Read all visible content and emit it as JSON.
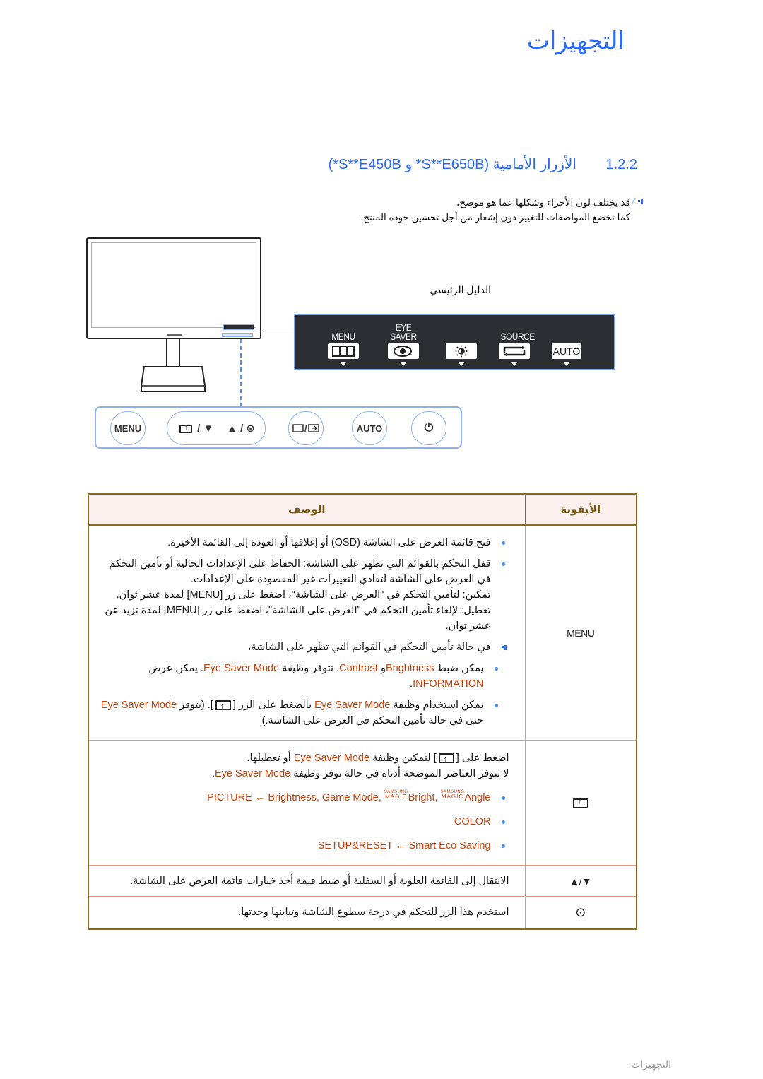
{
  "page": {
    "title": "التجهيزات",
    "footer": "التجهيزات"
  },
  "section": {
    "number": "1.2.2",
    "heading": "الأزرار الأمامية (S**E650B* و S**E450B*)"
  },
  "note": {
    "icon": "note-icon",
    "line1": "قد يختلف لون الأجزاء وشكلها عما هو موضح،",
    "line2": "كما تخضع المواصفات للتغيير دون إشعار من أجل تحسين جودة المنتج."
  },
  "key_guide": {
    "label": "الدليل الرئيسي",
    "keys": [
      {
        "top": "",
        "label": "MENU",
        "icon": "menu-grid-icon"
      },
      {
        "top": "EYE",
        "label": "SAVER",
        "icon": "eye-saver-icon"
      },
      {
        "top": "",
        "label": "",
        "icon": "brightness-icon"
      },
      {
        "top": "",
        "label": "SOURCE",
        "icon": "source-icon"
      },
      {
        "top": "",
        "label": "",
        "icon": "auto-icon",
        "box_text": "AUTO"
      }
    ]
  },
  "front_buttons": [
    {
      "label": "MENU",
      "name": "menu"
    },
    {
      "label": "▼",
      "name": "eye-saver-down"
    },
    {
      "label": "▲ / ⊙",
      "name": "up-brightness"
    },
    {
      "label": "",
      "name": "source-enter"
    },
    {
      "label": "AUTO",
      "name": "auto"
    },
    {
      "label": "⏻",
      "name": "power"
    }
  ],
  "table": {
    "headers": {
      "icon": "الأيقونة",
      "description": "الوصف"
    },
    "rows": [
      {
        "key": "MENU",
        "items": [
          "فتح قائمة العرض على الشاشة (OSD) أو إغلاقها أو العودة إلى القائمة الأخيرة.",
          "قفل التحكم بالقوائم التي تظهر على الشاشة: الحفاظ على الإعدادات الحالية أو تأمين التحكم في العرض على الشاشة لتفادي التغييرات غير المقصودة على الإعدادات.",
          "تمكين: لتأمين التحكم في \"العرض على الشاشة\"، اضغط على زر [MENU] لمدة عشر ثوان.",
          "تعطيل: لإلغاء تأمين التحكم في \"العرض على الشاشة\"، اضغط على زر [MENU] لمدة تزيد عن عشر ثوان."
        ],
        "note": "في حالة تأمين التحكم في القوائم التي تظهر على الشاشة،",
        "sub1_a": "يمكن ضبط",
        "sub1_brightness": "Brightness",
        "sub1_and": "و",
        "sub1_contrast": "Contrast",
        "sub1_b": ". تتوفر وظيفة",
        "sub1_eye": "Eye Saver Mode",
        "sub1_c": ". يمكن عرض",
        "sub1_info": "INFORMATION",
        "sub2_a": "يمكن استخدام وظيفة",
        "sub2_eye": "Eye Saver Mode",
        "sub2_b": "بالضغط على الزر",
        "sub2_c": ". (يتوفر",
        "sub2_eye2": "Eye Saver Mode",
        "sub2_d": "حتى في حالة تأمين التحكم في العرض على الشاشة.)"
      },
      {
        "key_icon": "eye-saver-key-icon",
        "line1_a": "اضغط على",
        "line1_b": "لتمكين وظيفة",
        "line1_eye": "Eye Saver Mode",
        "line1_c": "أو تعطيلها.",
        "line2_a": "لا تتوفر العناصر الموضحة أدناه في حالة توفر وظيفة",
        "line2_eye": "Eye Saver Mode",
        "items": [
          {
            "text": "PICTURE ← Brightness, Game Mode, ",
            "magic1": "Bright",
            "sep": ", ",
            "magic2": "Angle"
          },
          {
            "text": "COLOR"
          },
          {
            "text": "SETUP&RESET ← Smart Eco Saving"
          }
        ],
        "samsung": "SAMSUNG",
        "magic": "MAGIC"
      },
      {
        "key": "▲/▼",
        "text": "الانتقال إلى القائمة العلوية أو السفلية أو ضبط قيمة أحد خيارات قائمة العرض على الشاشة."
      },
      {
        "key": "⊙",
        "text": "استخدم هذا الزر للتحكم في درجة سطوع الشاشة وتباينها وحدتها."
      }
    ]
  },
  "colors": {
    "heading_blue": "#2a6bf2",
    "highlight_orange": "#c4410a",
    "table_border": "#8a6a1e",
    "cell_border": "#e59880"
  }
}
